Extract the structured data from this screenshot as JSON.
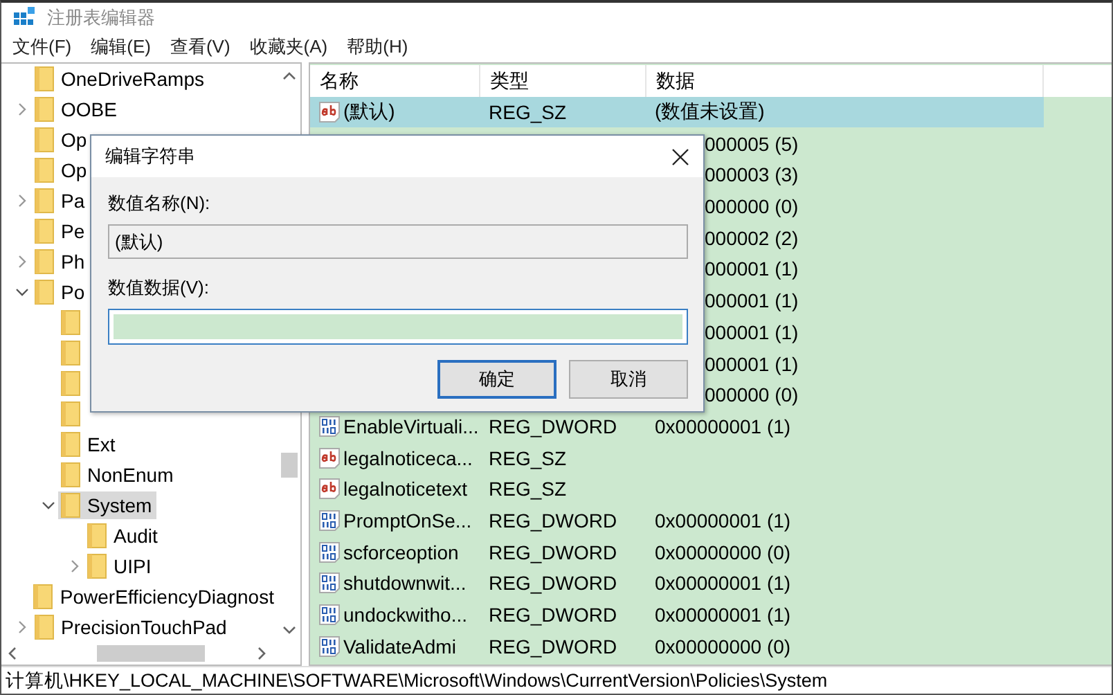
{
  "window": {
    "title": "注册表编辑器"
  },
  "menu": [
    "文件(F)",
    "编辑(E)",
    "查看(V)",
    "收藏夹(A)",
    "帮助(H)"
  ],
  "tree": [
    {
      "label": "OneDriveRamps",
      "selected": false
    },
    {
      "label": "OOBE",
      "expanded": false,
      "selected": false
    },
    {
      "label": "Op",
      "selected": false
    },
    {
      "label": "Op",
      "selected": false
    },
    {
      "label": "Pa",
      "expanded": false,
      "selected": false
    },
    {
      "label": "Pe",
      "selected": false
    },
    {
      "label": "Ph",
      "expanded": false,
      "selected": false
    },
    {
      "label": "Po",
      "expanded": true,
      "selected": false,
      "children": [
        {
          "selected": false
        },
        {
          "selected": false
        },
        {
          "selected": false
        },
        {
          "selected": false
        },
        {
          "label": "Ext",
          "selected": false
        },
        {
          "label": "NonEnum",
          "selected": false
        },
        {
          "label": "System",
          "expanded": true,
          "selected": true,
          "children": [
            {
              "label": "Audit",
              "selected": false
            },
            {
              "label": "UIPI",
              "expanded": false,
              "selected": false
            }
          ]
        }
      ]
    },
    {
      "label": "PowerEfficiencyDiagnost",
      "selected": false
    },
    {
      "label": "PrecisionTouchPad",
      "expanded": false,
      "selected": false
    }
  ],
  "columns": [
    "名称",
    "类型",
    "数据"
  ],
  "rows": [
    {
      "kind": "sz",
      "name": "(默认)",
      "type": "REG_SZ",
      "data": "(数值未设置)",
      "selected": true
    },
    {
      "data": "000005 (5)",
      "selected": false
    },
    {
      "data": "000003 (3)",
      "selected": false
    },
    {
      "data": "000000 (0)",
      "selected": false
    },
    {
      "data": "000002 (2)",
      "selected": false
    },
    {
      "data": "000001 (1)",
      "selected": false
    },
    {
      "data": "000001 (1)",
      "selected": false
    },
    {
      "data": "000001 (1)",
      "selected": false
    },
    {
      "data": "000001 (1)",
      "selected": false
    },
    {
      "data": "000000 (0)",
      "selected": false
    },
    {
      "kind": "dword",
      "name": "EnableVirtuali...",
      "type": "REG_DWORD",
      "data": "0x00000001 (1)",
      "selected": false
    },
    {
      "kind": "sz",
      "name": "legalnoticeca...",
      "type": "REG_SZ",
      "selected": false
    },
    {
      "kind": "sz",
      "name": "legalnoticetext",
      "type": "REG_SZ",
      "selected": false
    },
    {
      "kind": "dword",
      "name": "PromptOnSe...",
      "type": "REG_DWORD",
      "data": "0x00000001 (1)",
      "selected": false
    },
    {
      "kind": "dword",
      "name": "scforceoption",
      "type": "REG_DWORD",
      "data": "0x00000000 (0)",
      "selected": false
    },
    {
      "kind": "dword",
      "name": "shutdownwit...",
      "type": "REG_DWORD",
      "data": "0x00000001 (1)",
      "selected": false
    },
    {
      "kind": "dword",
      "name": "undockwitho...",
      "type": "REG_DWORD",
      "data": "0x00000001 (1)",
      "selected": false
    },
    {
      "kind": "dword",
      "name": "ValidateAdmi",
      "type": "REG_DWORD",
      "data": "0x00000000 (0)",
      "selected": false
    }
  ],
  "dialog": {
    "title": "编辑字符串",
    "name_label": "数值名称(N):",
    "name_value": "(默认)",
    "data_label": "数值数据(V):",
    "buttons": [
      {
        "label": "确定",
        "default": true
      },
      {
        "label": "取消",
        "default": false
      }
    ]
  },
  "status_bar": "计算机\\HKEY_LOCAL_MACHINE\\SOFTWARE\\Microsoft\\Windows\\CurrentVersion\\Policies\\System"
}
